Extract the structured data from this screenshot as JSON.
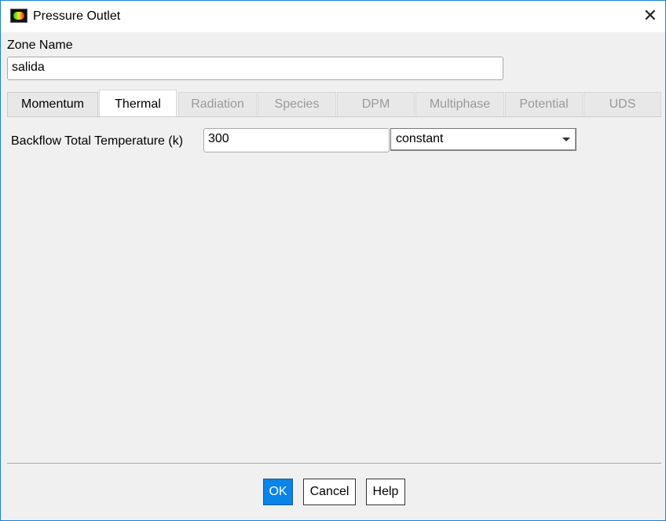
{
  "window": {
    "title": "Pressure Outlet",
    "close": "✕"
  },
  "zone": {
    "label": "Zone Name",
    "value": "salida"
  },
  "tabs": [
    {
      "label": "Momentum",
      "enabled": true
    },
    {
      "label": "Thermal",
      "active": true
    },
    {
      "label": "Radiation"
    },
    {
      "label": "Species"
    },
    {
      "label": "DPM"
    },
    {
      "label": "Multiphase"
    },
    {
      "label": "Potential"
    },
    {
      "label": "UDS"
    }
  ],
  "thermal": {
    "label": "Backflow Total Temperature (k)",
    "value": "300",
    "method": "constant"
  },
  "buttons": {
    "ok": "OK",
    "cancel": "Cancel",
    "help": "Help"
  }
}
